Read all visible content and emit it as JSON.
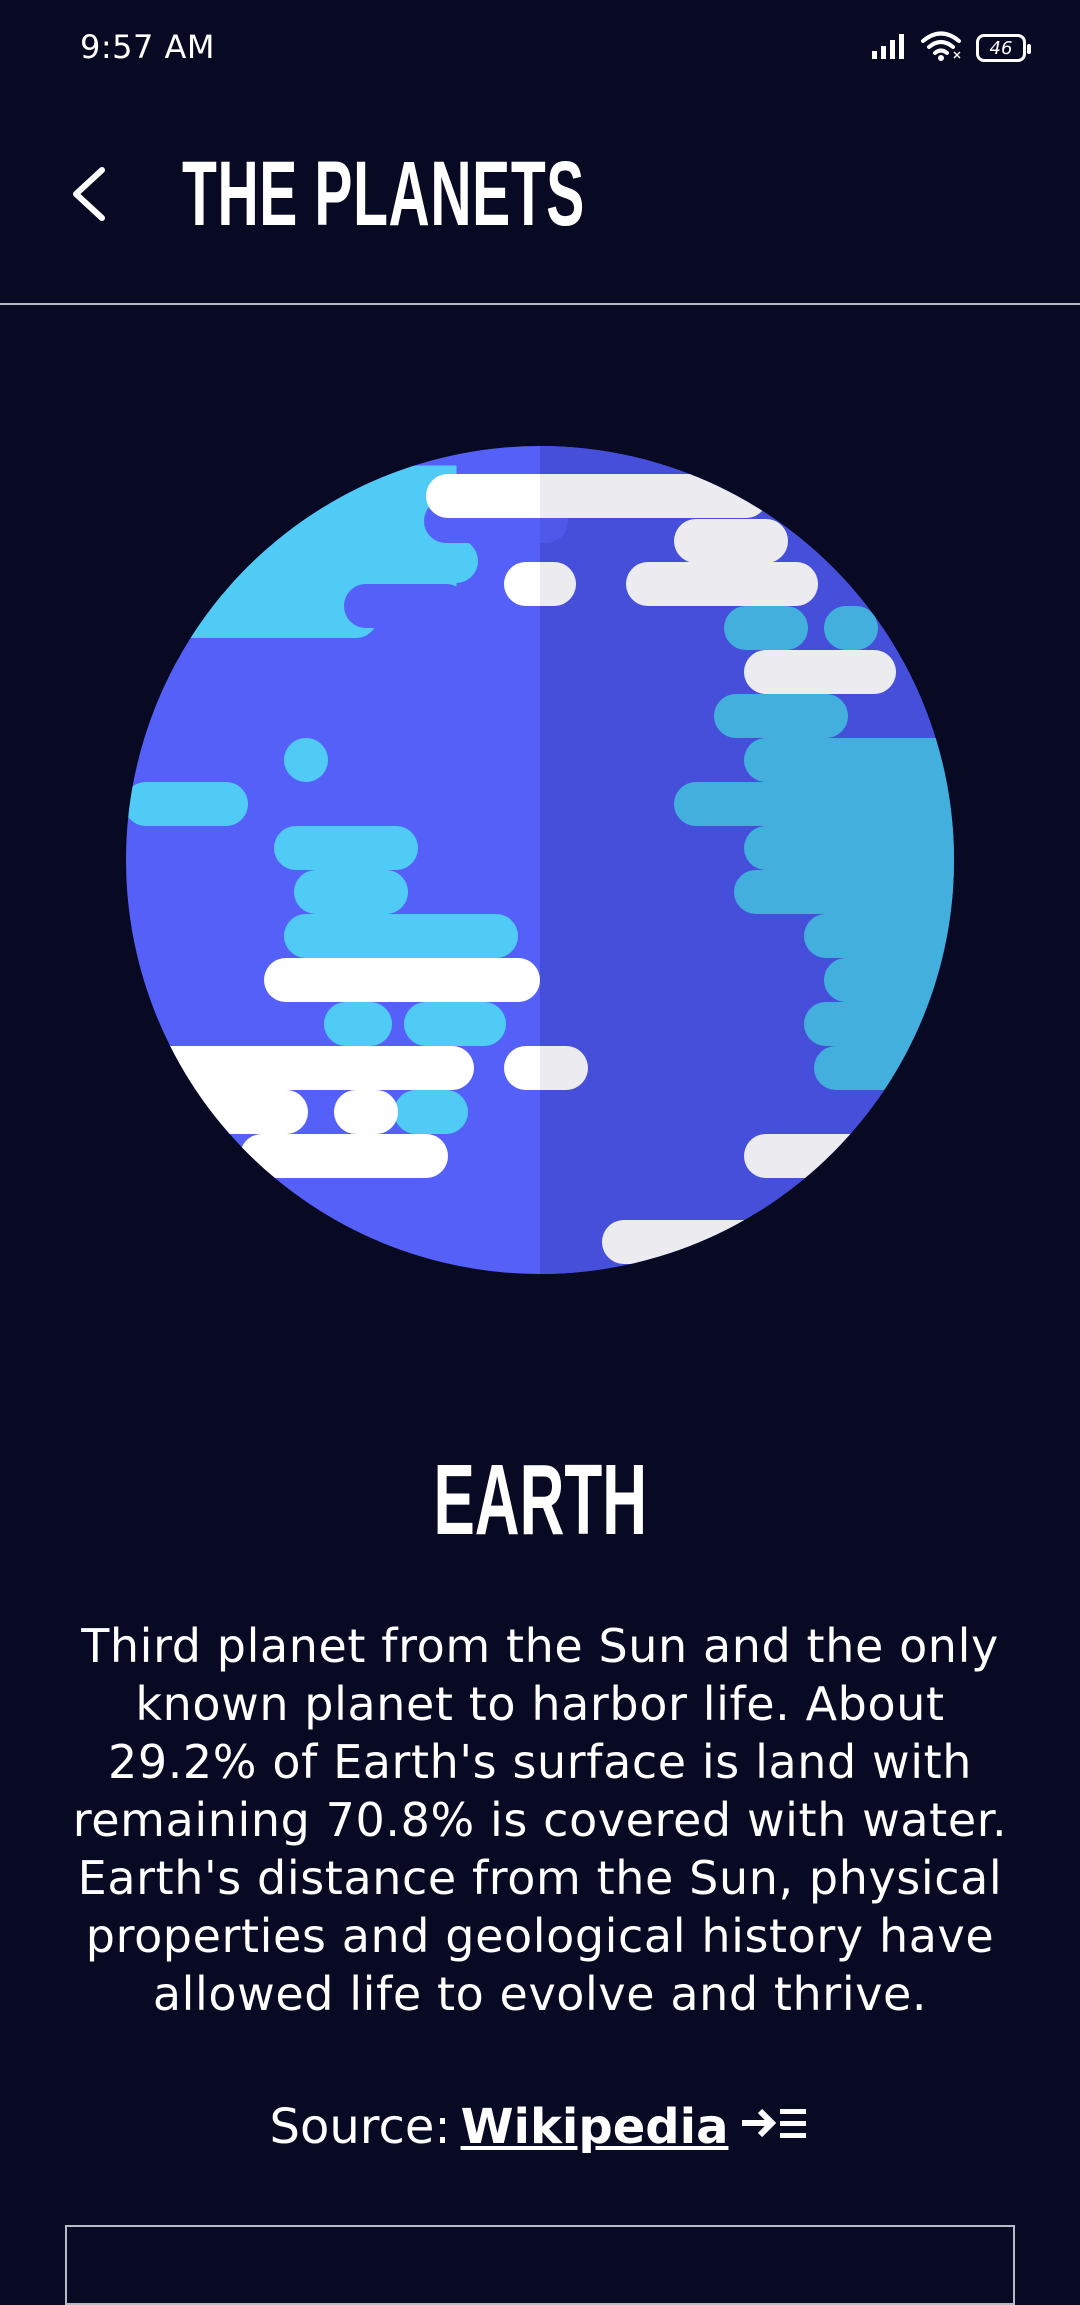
{
  "status_bar": {
    "time": "9:57 AM",
    "battery": "46",
    "icons": [
      "signal-icon",
      "wifi-icon",
      "battery-icon"
    ]
  },
  "header": {
    "title": "THE PLANETS",
    "back_icon": "chevron-left-icon"
  },
  "planet": {
    "name": "EARTH",
    "image_icon": "earth-illustration",
    "description": "Third planet from the Sun and the only known planet to harbor life. About 29.2% of Earth's surface is land with remaining 70.8% is covered with water. Earth's distance from the Sun, physical properties and geological history have allowed life to evolve and thrive."
  },
  "source": {
    "label": "Source:",
    "link_text": "Wikipedia",
    "link_icon": "external-link-icon"
  },
  "colors": {
    "background": "#070A22",
    "planet_blue": "#5560F8",
    "planet_blue_shadow": "#4A55E6",
    "ocean_cyan": "#4FCBF6",
    "cloud_white": "#FFFFFF",
    "divider": "#B8BAC6"
  }
}
